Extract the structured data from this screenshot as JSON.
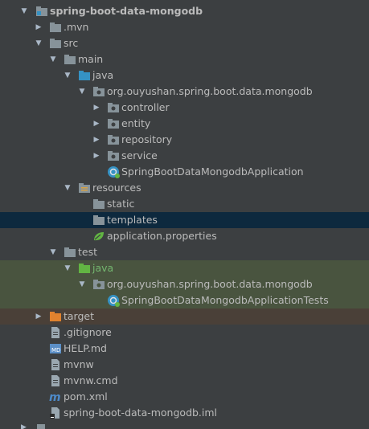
{
  "tree": [
    {
      "label": "spring-boot-data-mongodb",
      "bold": true
    },
    {
      "label": ".mvn"
    },
    {
      "label": "src"
    },
    {
      "label": "main"
    },
    {
      "label": "java"
    },
    {
      "label": "org.ouyushan.spring.boot.data.mongodb"
    },
    {
      "label": "controller"
    },
    {
      "label": "entity"
    },
    {
      "label": "repository"
    },
    {
      "label": "service"
    },
    {
      "label": "SpringBootDataMongodbApplication"
    },
    {
      "label": "resources"
    },
    {
      "label": "static"
    },
    {
      "label": "templates"
    },
    {
      "label": "application.properties"
    },
    {
      "label": "test"
    },
    {
      "label": "java"
    },
    {
      "label": "org.ouyushan.spring.boot.data.mongodb"
    },
    {
      "label": "SpringBootDataMongodbApplicationTests"
    },
    {
      "label": "target"
    },
    {
      "label": ".gitignore"
    },
    {
      "label": "HELP.md"
    },
    {
      "label": "mvnw"
    },
    {
      "label": "mvnw.cmd"
    },
    {
      "label": "pom.xml"
    },
    {
      "label": "spring-boot-data-mongodb.iml"
    }
  ],
  "colors": {
    "background": "#3c3f41",
    "selection": "#0d293e",
    "test_highlight": "#49543f",
    "excluded_highlight": "#4a4038"
  }
}
